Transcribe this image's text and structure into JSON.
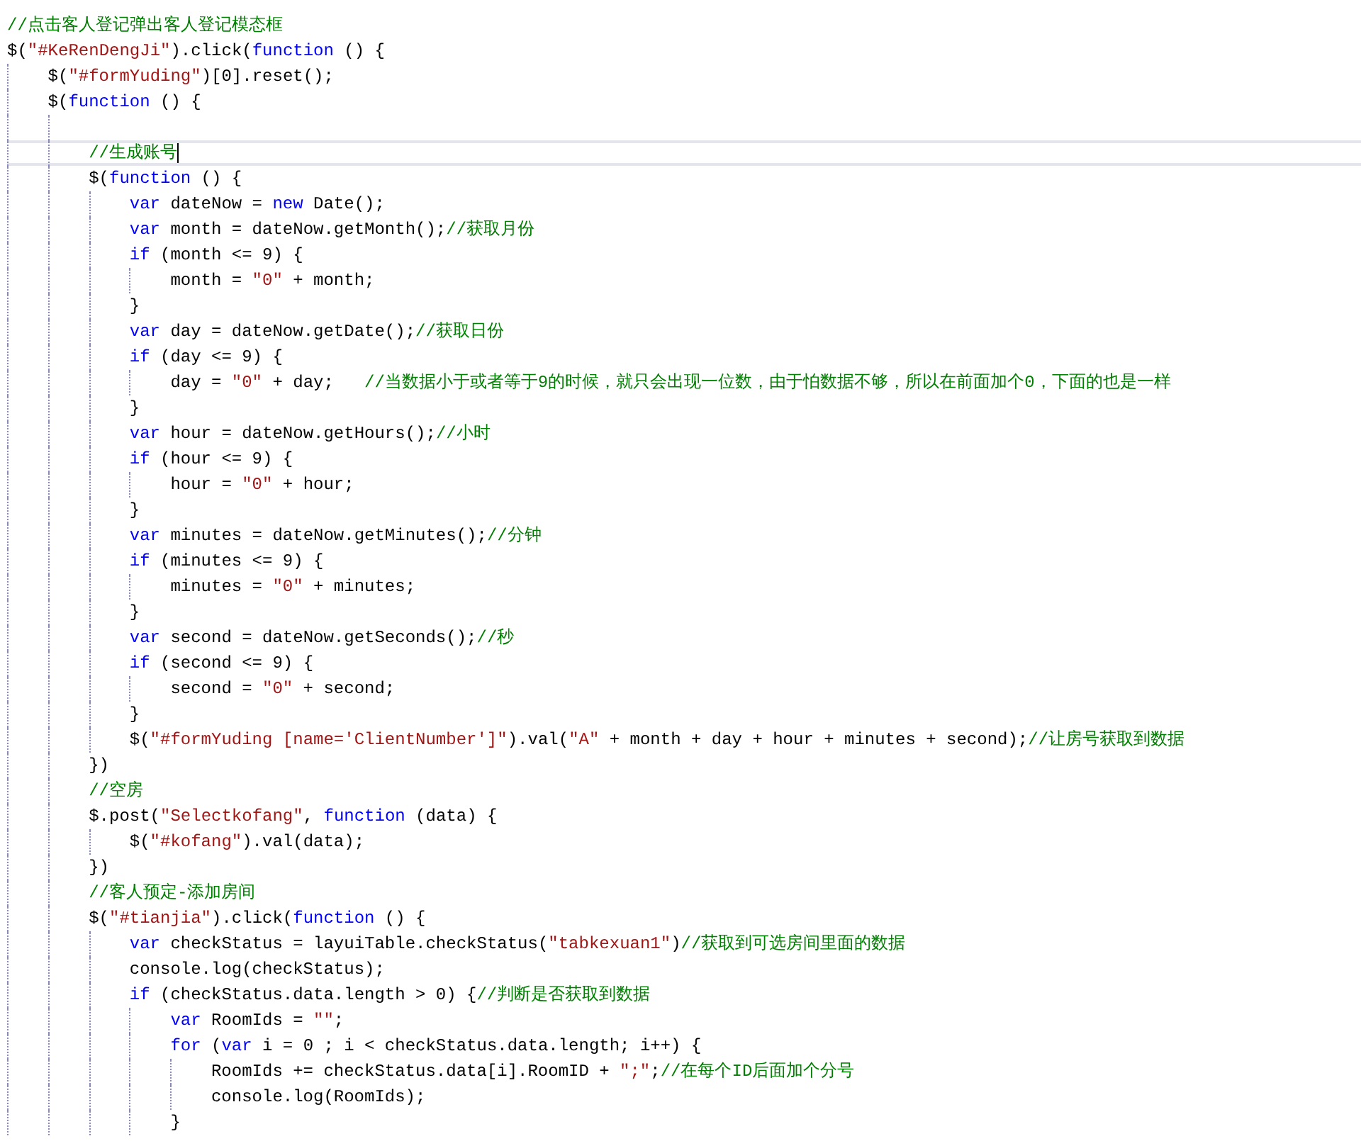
{
  "editor": {
    "lines": [
      {
        "kind": "code",
        "current": false,
        "tokens": [
          {
            "kind": "comment",
            "text": "//点击客人登记弹出客人登记模态框"
          }
        ]
      },
      {
        "kind": "code",
        "current": false,
        "tokens": [
          {
            "kind": "plain",
            "text": "$("
          },
          {
            "kind": "string",
            "text": "\"#KeRenDengJi\""
          },
          {
            "kind": "plain",
            "text": ").click("
          },
          {
            "kind": "keyword",
            "text": "function"
          },
          {
            "kind": "plain",
            "text": " () {"
          }
        ],
        "children": [
          {
            "kind": "code",
            "current": false,
            "tokens": [
              {
                "kind": "plain",
                "text": "$("
              },
              {
                "kind": "string",
                "text": "\"#formYuding\""
              },
              {
                "kind": "plain",
                "text": ")[0].reset();"
              }
            ]
          },
          {
            "kind": "code",
            "current": false,
            "tokens": [
              {
                "kind": "plain",
                "text": "$("
              },
              {
                "kind": "keyword",
                "text": "function"
              },
              {
                "kind": "plain",
                "text": " () {"
              }
            ],
            "children": [
              {
                "kind": "blank",
                "current": false
              },
              {
                "kind": "code",
                "current": true,
                "tokens": [
                  {
                    "kind": "comment",
                    "text": "//生成账号"
                  }
                ]
              },
              {
                "kind": "code",
                "current": false,
                "tokens": [
                  {
                    "kind": "plain",
                    "text": "$("
                  },
                  {
                    "kind": "keyword",
                    "text": "function"
                  },
                  {
                    "kind": "plain",
                    "text": " () {"
                  }
                ],
                "children": [
                  {
                    "kind": "code",
                    "current": false,
                    "tokens": [
                      {
                        "kind": "keyword",
                        "text": "var"
                      },
                      {
                        "kind": "plain",
                        "text": " dateNow = "
                      },
                      {
                        "kind": "keyword",
                        "text": "new"
                      },
                      {
                        "kind": "plain",
                        "text": " Date();"
                      }
                    ]
                  },
                  {
                    "kind": "code",
                    "current": false,
                    "tokens": [
                      {
                        "kind": "keyword",
                        "text": "var"
                      },
                      {
                        "kind": "plain",
                        "text": " month = dateNow.getMonth();"
                      },
                      {
                        "kind": "comment",
                        "text": "//获取月份"
                      }
                    ]
                  },
                  {
                    "kind": "code",
                    "current": false,
                    "tokens": [
                      {
                        "kind": "keyword",
                        "text": "if"
                      },
                      {
                        "kind": "plain",
                        "text": " (month <= 9) {"
                      }
                    ],
                    "children": [
                      {
                        "kind": "code",
                        "current": false,
                        "tokens": [
                          {
                            "kind": "plain",
                            "text": "month = "
                          },
                          {
                            "kind": "string",
                            "text": "\"0\""
                          },
                          {
                            "kind": "plain",
                            "text": " + month;"
                          }
                        ]
                      }
                    ]
                  },
                  {
                    "kind": "code",
                    "current": false,
                    "tokens": [
                      {
                        "kind": "plain",
                        "text": "}"
                      }
                    ]
                  },
                  {
                    "kind": "code",
                    "current": false,
                    "tokens": [
                      {
                        "kind": "keyword",
                        "text": "var"
                      },
                      {
                        "kind": "plain",
                        "text": " day = dateNow.getDate();"
                      },
                      {
                        "kind": "comment",
                        "text": "//获取日份"
                      }
                    ]
                  },
                  {
                    "kind": "code",
                    "current": false,
                    "tokens": [
                      {
                        "kind": "keyword",
                        "text": "if"
                      },
                      {
                        "kind": "plain",
                        "text": " (day <= 9) {"
                      }
                    ],
                    "children": [
                      {
                        "kind": "code",
                        "current": false,
                        "tokens": [
                          {
                            "kind": "plain",
                            "text": "day = "
                          },
                          {
                            "kind": "string",
                            "text": "\"0\""
                          },
                          {
                            "kind": "plain",
                            "text": " + day;   "
                          },
                          {
                            "kind": "comment",
                            "text": "//当数据小于或者等于9的时候，就只会出现一位数，由于怕数据不够，所以在前面加个0，下面的也是一样"
                          }
                        ]
                      }
                    ]
                  },
                  {
                    "kind": "code",
                    "current": false,
                    "tokens": [
                      {
                        "kind": "plain",
                        "text": "}"
                      }
                    ]
                  },
                  {
                    "kind": "code",
                    "current": false,
                    "tokens": [
                      {
                        "kind": "keyword",
                        "text": "var"
                      },
                      {
                        "kind": "plain",
                        "text": " hour = dateNow.getHours();"
                      },
                      {
                        "kind": "comment",
                        "text": "//小时"
                      }
                    ]
                  },
                  {
                    "kind": "code",
                    "current": false,
                    "tokens": [
                      {
                        "kind": "keyword",
                        "text": "if"
                      },
                      {
                        "kind": "plain",
                        "text": " (hour <= 9) {"
                      }
                    ],
                    "children": [
                      {
                        "kind": "code",
                        "current": false,
                        "tokens": [
                          {
                            "kind": "plain",
                            "text": "hour = "
                          },
                          {
                            "kind": "string",
                            "text": "\"0\""
                          },
                          {
                            "kind": "plain",
                            "text": " + hour;"
                          }
                        ]
                      }
                    ]
                  },
                  {
                    "kind": "code",
                    "current": false,
                    "tokens": [
                      {
                        "kind": "plain",
                        "text": "}"
                      }
                    ]
                  },
                  {
                    "kind": "code",
                    "current": false,
                    "tokens": [
                      {
                        "kind": "keyword",
                        "text": "var"
                      },
                      {
                        "kind": "plain",
                        "text": " minutes = dateNow.getMinutes();"
                      },
                      {
                        "kind": "comment",
                        "text": "//分钟"
                      }
                    ]
                  },
                  {
                    "kind": "code",
                    "current": false,
                    "tokens": [
                      {
                        "kind": "keyword",
                        "text": "if"
                      },
                      {
                        "kind": "plain",
                        "text": " (minutes <= 9) {"
                      }
                    ],
                    "children": [
                      {
                        "kind": "code",
                        "current": false,
                        "tokens": [
                          {
                            "kind": "plain",
                            "text": "minutes = "
                          },
                          {
                            "kind": "string",
                            "text": "\"0\""
                          },
                          {
                            "kind": "plain",
                            "text": " + minutes;"
                          }
                        ]
                      }
                    ]
                  },
                  {
                    "kind": "code",
                    "current": false,
                    "tokens": [
                      {
                        "kind": "plain",
                        "text": "}"
                      }
                    ]
                  },
                  {
                    "kind": "code",
                    "current": false,
                    "tokens": [
                      {
                        "kind": "keyword",
                        "text": "var"
                      },
                      {
                        "kind": "plain",
                        "text": " second = dateNow.getSeconds();"
                      },
                      {
                        "kind": "comment",
                        "text": "//秒"
                      }
                    ]
                  },
                  {
                    "kind": "code",
                    "current": false,
                    "tokens": [
                      {
                        "kind": "keyword",
                        "text": "if"
                      },
                      {
                        "kind": "plain",
                        "text": " (second <= 9) {"
                      }
                    ],
                    "children": [
                      {
                        "kind": "code",
                        "current": false,
                        "tokens": [
                          {
                            "kind": "plain",
                            "text": "second = "
                          },
                          {
                            "kind": "string",
                            "text": "\"0\""
                          },
                          {
                            "kind": "plain",
                            "text": " + second;"
                          }
                        ]
                      }
                    ]
                  },
                  {
                    "kind": "code",
                    "current": false,
                    "tokens": [
                      {
                        "kind": "plain",
                        "text": "}"
                      }
                    ]
                  },
                  {
                    "kind": "code",
                    "current": false,
                    "tokens": [
                      {
                        "kind": "plain",
                        "text": "$("
                      },
                      {
                        "kind": "string",
                        "text": "\"#formYuding [name='ClientNumber']\""
                      },
                      {
                        "kind": "plain",
                        "text": ").val("
                      },
                      {
                        "kind": "string",
                        "text": "\"A\""
                      },
                      {
                        "kind": "plain",
                        "text": " + month + day + hour + minutes + second);"
                      },
                      {
                        "kind": "comment",
                        "text": "//让房号获取到数据"
                      }
                    ]
                  }
                ]
              },
              {
                "kind": "code",
                "current": false,
                "tokens": [
                  {
                    "kind": "plain",
                    "text": "})"
                  }
                ]
              },
              {
                "kind": "code",
                "current": false,
                "tokens": [
                  {
                    "kind": "comment",
                    "text": "//空房"
                  }
                ]
              },
              {
                "kind": "code",
                "current": false,
                "tokens": [
                  {
                    "kind": "plain",
                    "text": "$.post("
                  },
                  {
                    "kind": "string",
                    "text": "\"Selectkofang\""
                  },
                  {
                    "kind": "plain",
                    "text": ", "
                  },
                  {
                    "kind": "keyword",
                    "text": "function"
                  },
                  {
                    "kind": "plain",
                    "text": " (data) {"
                  }
                ],
                "children": [
                  {
                    "kind": "code",
                    "current": false,
                    "tokens": [
                      {
                        "kind": "plain",
                        "text": "$("
                      },
                      {
                        "kind": "string",
                        "text": "\"#kofang\""
                      },
                      {
                        "kind": "plain",
                        "text": ").val(data);"
                      }
                    ]
                  }
                ]
              },
              {
                "kind": "code",
                "current": false,
                "tokens": [
                  {
                    "kind": "plain",
                    "text": "})"
                  }
                ]
              },
              {
                "kind": "code",
                "current": false,
                "tokens": [
                  {
                    "kind": "comment",
                    "text": "//客人预定-添加房间"
                  }
                ]
              },
              {
                "kind": "code",
                "current": false,
                "tokens": [
                  {
                    "kind": "plain",
                    "text": "$("
                  },
                  {
                    "kind": "string",
                    "text": "\"#tianjia\""
                  },
                  {
                    "kind": "plain",
                    "text": ").click("
                  },
                  {
                    "kind": "keyword",
                    "text": "function"
                  },
                  {
                    "kind": "plain",
                    "text": " () {"
                  }
                ],
                "children": [
                  {
                    "kind": "code",
                    "current": false,
                    "tokens": [
                      {
                        "kind": "keyword",
                        "text": "var"
                      },
                      {
                        "kind": "plain",
                        "text": " checkStatus = layuiTable.checkStatus("
                      },
                      {
                        "kind": "string",
                        "text": "\"tabkexuan1\""
                      },
                      {
                        "kind": "plain",
                        "text": ")"
                      },
                      {
                        "kind": "comment",
                        "text": "//获取到可选房间里面的数据"
                      }
                    ]
                  },
                  {
                    "kind": "code",
                    "current": false,
                    "tokens": [
                      {
                        "kind": "plain",
                        "text": "console.log(checkStatus);"
                      }
                    ]
                  },
                  {
                    "kind": "code",
                    "current": false,
                    "tokens": [
                      {
                        "kind": "keyword",
                        "text": "if"
                      },
                      {
                        "kind": "plain",
                        "text": " (checkStatus.data.length > 0) {"
                      },
                      {
                        "kind": "comment",
                        "text": "//判断是否获取到数据"
                      }
                    ],
                    "children": [
                      {
                        "kind": "code",
                        "current": false,
                        "tokens": [
                          {
                            "kind": "keyword",
                            "text": "var"
                          },
                          {
                            "kind": "plain",
                            "text": " RoomIds = "
                          },
                          {
                            "kind": "string",
                            "text": "\"\""
                          },
                          {
                            "kind": "plain",
                            "text": ";"
                          }
                        ]
                      },
                      {
                        "kind": "code",
                        "current": false,
                        "tokens": [
                          {
                            "kind": "keyword",
                            "text": "for"
                          },
                          {
                            "kind": "plain",
                            "text": " ("
                          },
                          {
                            "kind": "keyword",
                            "text": "var"
                          },
                          {
                            "kind": "plain",
                            "text": " i = 0 ; i < checkStatus.data.length; i++) {"
                          }
                        ],
                        "children": [
                          {
                            "kind": "code",
                            "current": false,
                            "tokens": [
                              {
                                "kind": "plain",
                                "text": "RoomIds += checkStatus.data[i].RoomID + "
                              },
                              {
                                "kind": "string",
                                "text": "\";\""
                              },
                              {
                                "kind": "plain",
                                "text": ";"
                              },
                              {
                                "kind": "comment",
                                "text": "//在每个ID后面加个分号"
                              }
                            ]
                          },
                          {
                            "kind": "code",
                            "current": false,
                            "tokens": [
                              {
                                "kind": "plain",
                                "text": "console.log(RoomIds);"
                              }
                            ]
                          }
                        ]
                      },
                      {
                        "kind": "code",
                        "current": false,
                        "tokens": [
                          {
                            "kind": "plain",
                            "text": "}"
                          }
                        ]
                      }
                    ]
                  }
                ]
              }
            ]
          }
        ]
      }
    ]
  }
}
